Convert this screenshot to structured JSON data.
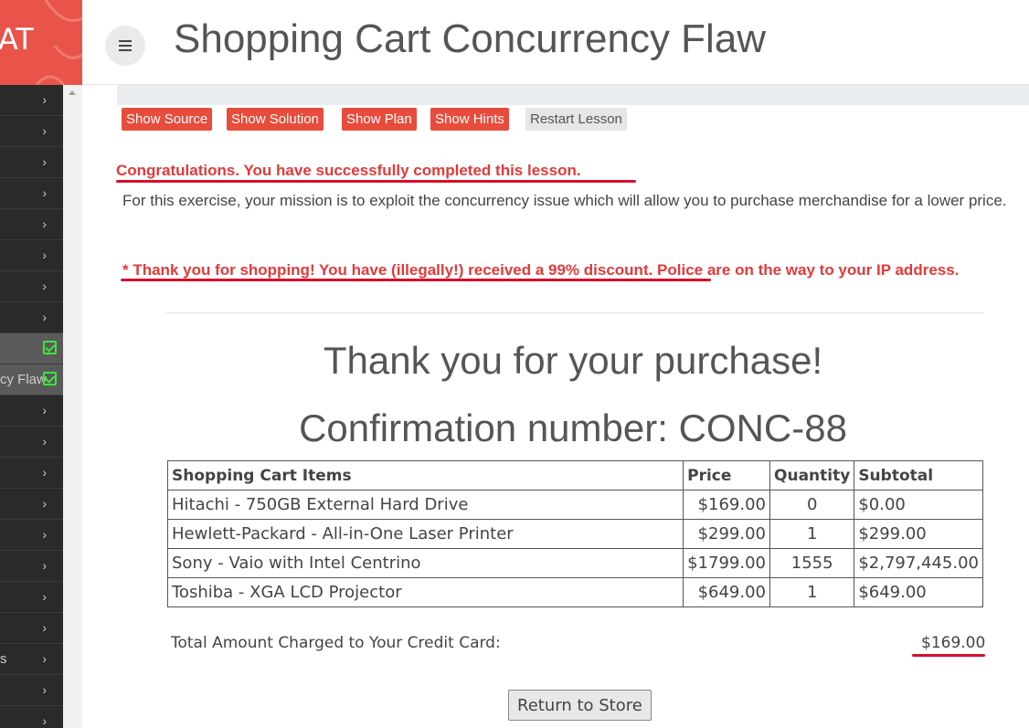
{
  "logo": {
    "text": "AT"
  },
  "header": {
    "title": "Shopping Cart Concurrency Flaw"
  },
  "sidebar": {
    "active_label": "cy Flaw",
    "bottom_label": "s"
  },
  "toolbar": {
    "show_source": "Show Source",
    "show_solution": "Show Solution",
    "show_plan": "Show Plan",
    "show_hints": "Show Hints",
    "restart_lesson": "Restart Lesson"
  },
  "lesson": {
    "congrats": "Congratulations. You have successfully completed this lesson.",
    "mission": "For this exercise, your mission is to exploit the concurrency issue which will allow you to purchase merchandise for a lower price.",
    "thanks_message": "* Thank you for shopping! You have (illegally!) received a 99% discount. Police are on the way to your IP address."
  },
  "purchase": {
    "heading": "Thank you for your purchase!",
    "confirmation": "Confirmation number: CONC-88"
  },
  "cart": {
    "headers": [
      "Shopping Cart Items",
      "Price",
      "Quantity",
      "Subtotal"
    ],
    "rows": [
      {
        "item": "Hitachi - 750GB External Hard Drive",
        "price": "$169.00",
        "qty": "0",
        "subtotal": "$0.00"
      },
      {
        "item": "Hewlett-Packard - All-in-One Laser Printer",
        "price": "$299.00",
        "qty": "1",
        "subtotal": "$299.00"
      },
      {
        "item": "Sony - Vaio with Intel Centrino",
        "price": "$1799.00",
        "qty": "1555",
        "subtotal": "$2,797,445.00"
      },
      {
        "item": "Toshiba - XGA LCD Projector",
        "price": "$649.00",
        "qty": "1",
        "subtotal": "$649.00"
      }
    ]
  },
  "total": {
    "label": "Total Amount Charged to Your Credit Card:",
    "value": "$169.00"
  },
  "return_button": "Return to Store",
  "colors": {
    "brand": "#e9534a",
    "button_red": "#e74c3c",
    "success_text": "#e13a3a",
    "annotation_underline": "#d5102a",
    "check": "#3ee43e"
  }
}
